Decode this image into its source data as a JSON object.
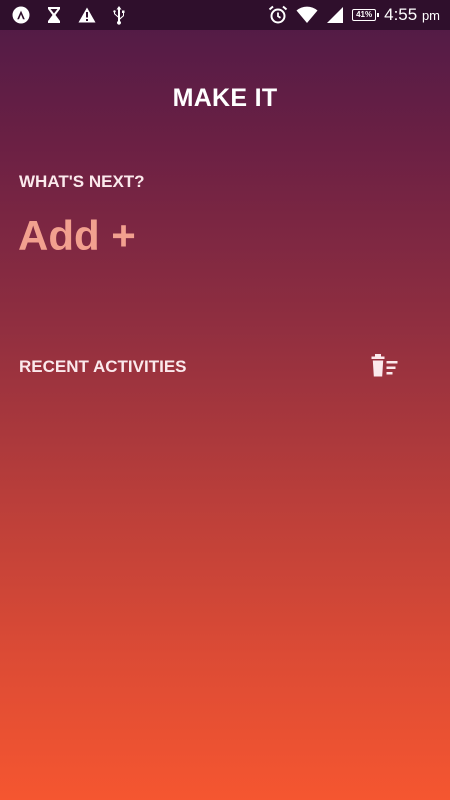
{
  "status_bar": {
    "icons_left": [
      "app-logo-icon",
      "hourglass-icon",
      "warning-icon",
      "usb-icon"
    ],
    "icons_right": [
      "alarm-icon",
      "wifi-icon",
      "signal-icon"
    ],
    "battery": "41%",
    "time": "4:55",
    "ampm": "pm"
  },
  "app": {
    "title": "MAKE IT"
  },
  "next": {
    "label": "WHAT'S NEXT?",
    "add_label": "Add +"
  },
  "recent": {
    "label": "RECENT ACTIVITIES",
    "clear_icon": "delete-sweep-icon"
  },
  "colors": {
    "gradient_top": "#4e1a47",
    "gradient_bottom": "#f55630",
    "add_accent": "#f2a08f"
  }
}
